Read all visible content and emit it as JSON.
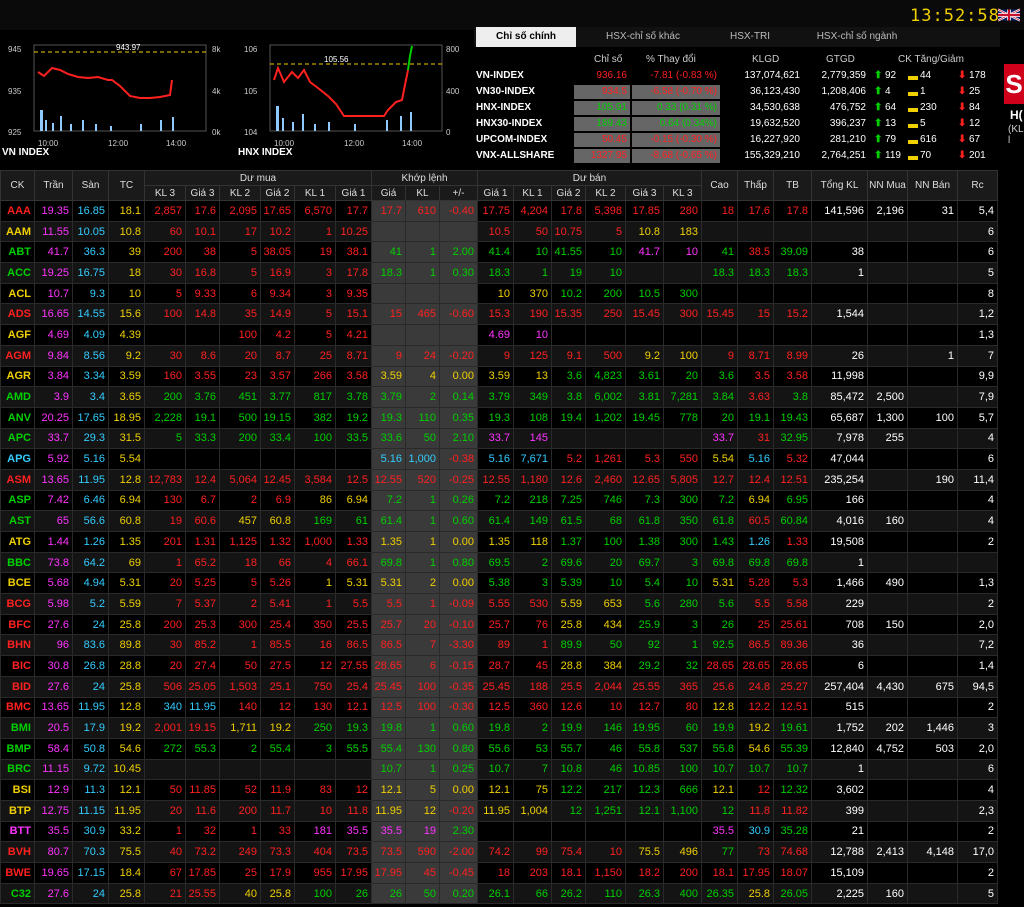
{
  "clock": "13:52:58",
  "charts": [
    {
      "title": "VN INDEX",
      "ref_label": "943.97",
      "y_left": [
        "945",
        "935",
        "925"
      ],
      "y_right": [
        "8k",
        "4k",
        "0k"
      ],
      "x": [
        "10:00",
        "12:00",
        "14:00"
      ]
    },
    {
      "title": "HNX INDEX",
      "ref_label": "105.56",
      "y_left": [
        "106",
        "105",
        "104"
      ],
      "y_right": [
        "800",
        "400",
        "0"
      ],
      "x": [
        "10:00",
        "12:00",
        "14:00"
      ]
    }
  ],
  "tabs": [
    "Chỉ số chính",
    "HSX-chỉ số khác",
    "HSX-TRI",
    "HSX-chỉ số ngành"
  ],
  "index_headers": [
    "Chỉ số",
    "% Thay đổi",
    "KLGD",
    "GTGD",
    "CK Tăng/Giảm"
  ],
  "indices": [
    {
      "name": "VN-INDEX",
      "value": "936.16",
      "change": "-7.81 (-0.83 %)",
      "klgd": "137,074,621",
      "gtgd": "2,779,359",
      "up": "92",
      "ref": "44",
      "down": "178"
    },
    {
      "name": "VN30-INDEX",
      "value": "934.5",
      "change": "-6.58 (-0.70 %)",
      "klgd": "36,123,430",
      "gtgd": "1,208,406",
      "up": "4",
      "ref": "1",
      "down": "25"
    },
    {
      "name": "HNX-INDEX",
      "value": "105.91",
      "change": "0.33 (0.31 %)",
      "klgd": "34,530,638",
      "gtgd": "476,752",
      "up": "64",
      "ref": "230",
      "down": "84"
    },
    {
      "name": "HNX30-INDEX",
      "value": "189.43",
      "change": "0.64 (0.34%)",
      "klgd": "19,632,520",
      "gtgd": "396,237",
      "up": "13",
      "ref": "5",
      "down": "12"
    },
    {
      "name": "UPCOM-INDEX",
      "value": "50.45",
      "change": "-0.15 (-0.30 %)",
      "klgd": "16,227,920",
      "gtgd": "281,210",
      "up": "79",
      "ref": "616",
      "down": "67"
    },
    {
      "name": "VNX-ALLSHARE",
      "value": "1327.95",
      "change": "-8.68 (-0.65 %)",
      "klgd": "155,329,210",
      "gtgd": "2,764,251",
      "up": "119",
      "ref": "70",
      "down": "201"
    }
  ],
  "logo_letter": "S",
  "logo_t1": "H(",
  "logo_t2": "(KL l",
  "board_group_headers": [
    "CK",
    "Trần",
    "Sàn",
    "TC",
    "Dư mua",
    "Khớp lệnh",
    "Dư bán",
    "Cao",
    "Thấp",
    "TB",
    "Tổng KL",
    "NN Mua",
    "NN Bán",
    "Rc"
  ],
  "board_sub_headers": [
    "KL 3",
    "Giá 3",
    "KL 2",
    "Giá 2",
    "KL 1",
    "Giá 1",
    "Giá",
    "KL",
    "+/-",
    "Giá 1",
    "KL 1",
    "Giá 2",
    "KL 2",
    "Giá 3",
    "KL 3"
  ],
  "rows": [
    [
      "AAA",
      "19.35",
      "16.85",
      "18.1",
      "2,857",
      "17.6",
      "2,095",
      "17.65",
      "6,570",
      "17.7",
      "17.7",
      "610",
      "-0.40",
      "17.75",
      "4,204",
      "17.8",
      "5,398",
      "17.85",
      "280",
      "18",
      "17.6",
      "17.8",
      "141,596",
      "2,196",
      "31",
      "5,4"
    ],
    [
      "AAM",
      "11.55",
      "10.05",
      "10.8",
      "60",
      "10.1",
      "17",
      "10.2",
      "1",
      "10.25",
      "",
      "",
      "",
      "10.5",
      "50",
      "10.75",
      "5",
      "10.8",
      "183",
      "",
      "",
      "",
      "",
      "",
      "",
      "6"
    ],
    [
      "ABT",
      "41.7",
      "36.3",
      "39",
      "200",
      "38",
      "5",
      "38.05",
      "19",
      "38.1",
      "41",
      "1",
      "2.00",
      "41.4",
      "10",
      "41.55",
      "10",
      "41.7",
      "10",
      "41",
      "38.5",
      "39.09",
      "38",
      "",
      "",
      "6"
    ],
    [
      "ACC",
      "19.25",
      "16.75",
      "18",
      "30",
      "16.8",
      "5",
      "16.9",
      "3",
      "17.8",
      "18.3",
      "1",
      "0.30",
      "18.3",
      "1",
      "19",
      "10",
      "",
      "",
      "18.3",
      "18.3",
      "18.3",
      "1",
      "",
      "",
      "5"
    ],
    [
      "ACL",
      "10.7",
      "9.3",
      "10",
      "5",
      "9.33",
      "6",
      "9.34",
      "3",
      "9.35",
      "",
      "",
      "",
      "10",
      "370",
      "10.2",
      "200",
      "10.5",
      "300",
      "",
      "",
      "",
      "",
      "",
      "",
      "8"
    ],
    [
      "ADS",
      "16.65",
      "14.55",
      "15.6",
      "100",
      "14.8",
      "35",
      "14.9",
      "5",
      "15.1",
      "15",
      "465",
      "-0.60",
      "15.3",
      "190",
      "15.35",
      "250",
      "15.45",
      "300",
      "15.45",
      "15",
      "15.2",
      "1,544",
      "",
      "",
      "1,2"
    ],
    [
      "AGF",
      "4.69",
      "4.09",
      "4.39",
      "",
      "",
      "100",
      "4.2",
      "5",
      "4.21",
      "",
      "",
      "",
      "4.69",
      "10",
      "",
      "",
      "",
      "",
      "",
      "",
      "",
      "",
      "",
      "",
      "1,3"
    ],
    [
      "AGM",
      "9.84",
      "8.56",
      "9.2",
      "30",
      "8.6",
      "20",
      "8.7",
      "25",
      "8.71",
      "9",
      "24",
      "-0.20",
      "9",
      "125",
      "9.1",
      "500",
      "9.2",
      "100",
      "9",
      "8.71",
      "8.99",
      "26",
      "",
      "1",
      "7"
    ],
    [
      "AGR",
      "3.84",
      "3.34",
      "3.59",
      "160",
      "3.55",
      "23",
      "3.57",
      "266",
      "3.58",
      "3.59",
      "4",
      "0.00",
      "3.59",
      "13",
      "3.6",
      "4,823",
      "3.61",
      "20",
      "3.6",
      "3.5",
      "3.58",
      "11,998",
      "",
      "",
      "9,9"
    ],
    [
      "AMD",
      "3.9",
      "3.4",
      "3.65",
      "200",
      "3.76",
      "451",
      "3.77",
      "817",
      "3.78",
      "3.79",
      "2",
      "0.14",
      "3.79",
      "349",
      "3.8",
      "6,002",
      "3.81",
      "7,281",
      "3.84",
      "3.63",
      "3.8",
      "85,472",
      "2,500",
      "",
      "7,9"
    ],
    [
      "ANV",
      "20.25",
      "17.65",
      "18.95",
      "2,228",
      "19.1",
      "500",
      "19.15",
      "382",
      "19.2",
      "19.3",
      "110",
      "0.35",
      "19.3",
      "108",
      "19.4",
      "1,202",
      "19.45",
      "778",
      "20",
      "19.1",
      "19.43",
      "65,687",
      "1,300",
      "100",
      "5,7"
    ],
    [
      "APC",
      "33.7",
      "29.3",
      "31.5",
      "5",
      "33.3",
      "200",
      "33.4",
      "100",
      "33.5",
      "33.6",
      "50",
      "2.10",
      "33.7",
      "145",
      "",
      "",
      "",
      "",
      "33.7",
      "31",
      "32.95",
      "7,978",
      "255",
      "",
      "4"
    ],
    [
      "APG",
      "5.92",
      "5.16",
      "5.54",
      "",
      "",
      "",
      "",
      "",
      "",
      "5.16",
      "1,000",
      "-0.38",
      "5.16",
      "7,671",
      "5.2",
      "1,261",
      "5.3",
      "550",
      "5.54",
      "5.16",
      "5.32",
      "47,044",
      "",
      "",
      "6"
    ],
    [
      "ASM",
      "13.65",
      "11.95",
      "12.8",
      "12,783",
      "12.4",
      "5,064",
      "12.45",
      "3,584",
      "12.5",
      "12.55",
      "520",
      "-0.25",
      "12.55",
      "1,180",
      "12.6",
      "2,460",
      "12.65",
      "5,805",
      "12.7",
      "12.4",
      "12.51",
      "235,254",
      "",
      "190",
      "11,4"
    ],
    [
      "ASP",
      "7.42",
      "6.46",
      "6.94",
      "130",
      "6.7",
      "2",
      "6.9",
      "86",
      "6.94",
      "7.2",
      "1",
      "0.26",
      "7.2",
      "218",
      "7.25",
      "746",
      "7.3",
      "300",
      "7.2",
      "6.94",
      "6.95",
      "166",
      "",
      "",
      "4"
    ],
    [
      "AST",
      "65",
      "56.6",
      "60.8",
      "19",
      "60.6",
      "457",
      "60.8",
      "169",
      "61",
      "61.4",
      "1",
      "0.60",
      "61.4",
      "149",
      "61.5",
      "68",
      "61.8",
      "350",
      "61.8",
      "60.5",
      "60.84",
      "4,016",
      "160",
      "",
      "4"
    ],
    [
      "ATG",
      "1.44",
      "1.26",
      "1.35",
      "201",
      "1.31",
      "1,125",
      "1.32",
      "1,000",
      "1.33",
      "1.35",
      "1",
      "0.00",
      "1.35",
      "118",
      "1.37",
      "100",
      "1.38",
      "300",
      "1.43",
      "1.26",
      "1.33",
      "19,508",
      "",
      "",
      "2"
    ],
    [
      "BBC",
      "73.8",
      "64.2",
      "69",
      "1",
      "65.2",
      "18",
      "66",
      "4",
      "66.1",
      "69.8",
      "1",
      "0.80",
      "69.5",
      "2",
      "69.6",
      "20",
      "69.7",
      "3",
      "69.8",
      "69.8",
      "69.8",
      "1",
      "",
      "",
      ""
    ],
    [
      "BCE",
      "5.68",
      "4.94",
      "5.31",
      "20",
      "5.25",
      "5",
      "5.26",
      "1",
      "5.31",
      "5.31",
      "2",
      "0.00",
      "5.38",
      "3",
      "5.39",
      "10",
      "5.4",
      "10",
      "5.31",
      "5.28",
      "5.3",
      "1,466",
      "490",
      "",
      "1,3"
    ],
    [
      "BCG",
      "5.98",
      "5.2",
      "5.59",
      "7",
      "5.37",
      "2",
      "5.41",
      "1",
      "5.5",
      "5.5",
      "1",
      "-0.09",
      "5.55",
      "530",
      "5.59",
      "653",
      "5.6",
      "280",
      "5.6",
      "5.5",
      "5.58",
      "229",
      "",
      "",
      "2"
    ],
    [
      "BFC",
      "27.6",
      "24",
      "25.8",
      "200",
      "25.3",
      "300",
      "25.4",
      "350",
      "25.5",
      "25.7",
      "20",
      "-0.10",
      "25.7",
      "76",
      "25.8",
      "434",
      "25.9",
      "3",
      "26",
      "25",
      "25.61",
      "708",
      "150",
      "",
      "2,0"
    ],
    [
      "BHN",
      "96",
      "83.6",
      "89.8",
      "30",
      "85.2",
      "1",
      "85.5",
      "16",
      "86.5",
      "86.5",
      "7",
      "-3.30",
      "89",
      "1",
      "89.9",
      "50",
      "92",
      "1",
      "92.5",
      "86.5",
      "89.36",
      "36",
      "",
      "",
      "7,2"
    ],
    [
      "BIC",
      "30.8",
      "26.8",
      "28.8",
      "20",
      "27.4",
      "50",
      "27.5",
      "12",
      "27.55",
      "28.65",
      "6",
      "-0.15",
      "28.7",
      "45",
      "28.8",
      "384",
      "29.2",
      "32",
      "28.65",
      "28.65",
      "28.65",
      "6",
      "",
      "",
      "1,4"
    ],
    [
      "BID",
      "27.6",
      "24",
      "25.8",
      "506",
      "25.05",
      "1,503",
      "25.1",
      "750",
      "25.4",
      "25.45",
      "100",
      "-0.35",
      "25.45",
      "188",
      "25.5",
      "2,044",
      "25.55",
      "365",
      "25.6",
      "24.8",
      "25.27",
      "257,404",
      "4,430",
      "675",
      "94,5"
    ],
    [
      "BMC",
      "13.65",
      "11.95",
      "12.8",
      "340",
      "11.95",
      "140",
      "12",
      "130",
      "12.1",
      "12.5",
      "100",
      "-0.30",
      "12.5",
      "360",
      "12.6",
      "10",
      "12.7",
      "80",
      "12.8",
      "12.2",
      "12.51",
      "515",
      "",
      "",
      "2"
    ],
    [
      "BMI",
      "20.5",
      "17.9",
      "19.2",
      "2,001",
      "19.15",
      "1,711",
      "19.2",
      "250",
      "19.3",
      "19.8",
      "1",
      "0.60",
      "19.8",
      "2",
      "19.9",
      "146",
      "19.95",
      "60",
      "19.9",
      "19.2",
      "19.61",
      "1,752",
      "202",
      "1,446",
      "3"
    ],
    [
      "BMP",
      "58.4",
      "50.8",
      "54.6",
      "272",
      "55.3",
      "2",
      "55.4",
      "3",
      "55.5",
      "55.4",
      "130",
      "0.80",
      "55.6",
      "53",
      "55.7",
      "46",
      "55.8",
      "537",
      "55.8",
      "54.6",
      "55.39",
      "12,840",
      "4,752",
      "503",
      "2,0"
    ],
    [
      "BRC",
      "11.15",
      "9.72",
      "10.45",
      "",
      "",
      "",
      "",
      "",
      "",
      "10.7",
      "1",
      "0.25",
      "10.7",
      "7",
      "10.8",
      "46",
      "10.85",
      "100",
      "10.7",
      "10.7",
      "10.7",
      "1",
      "",
      "",
      "6"
    ],
    [
      "BSI",
      "12.9",
      "11.3",
      "12.1",
      "50",
      "11.85",
      "52",
      "11.9",
      "83",
      "12",
      "12.1",
      "5",
      "0.00",
      "12.1",
      "75",
      "12.2",
      "217",
      "12.3",
      "666",
      "12.1",
      "12",
      "12.32",
      "3,602",
      "",
      "",
      "4"
    ],
    [
      "BTP",
      "12.75",
      "11.15",
      "11.95",
      "20",
      "11.6",
      "200",
      "11.7",
      "10",
      "11.8",
      "11.95",
      "12",
      "-0.20",
      "11.95",
      "1,004",
      "12",
      "1,251",
      "12.1",
      "1,100",
      "12",
      "11.8",
      "11.82",
      "399",
      "",
      "",
      "2,3"
    ],
    [
      "BTT",
      "35.5",
      "30.9",
      "33.2",
      "1",
      "32",
      "1",
      "33",
      "181",
      "35.5",
      "35.5",
      "19",
      "2.30",
      "",
      "",
      "",
      "",
      "",
      "",
      "35.5",
      "30.9",
      "35.28",
      "21",
      "",
      "",
      "2"
    ],
    [
      "BVH",
      "80.7",
      "70.3",
      "75.5",
      "40",
      "73.2",
      "249",
      "73.3",
      "404",
      "73.5",
      "73.5",
      "590",
      "-2.00",
      "74.2",
      "99",
      "75.4",
      "10",
      "75.5",
      "496",
      "77",
      "73",
      "74.68",
      "12,788",
      "2,413",
      "4,148",
      "17,0"
    ],
    [
      "BWE",
      "19.65",
      "17.15",
      "18.4",
      "67",
      "17.85",
      "25",
      "17.9",
      "955",
      "17.95",
      "17.95",
      "45",
      "-0.45",
      "18",
      "203",
      "18.1",
      "1,150",
      "18.2",
      "200",
      "18.1",
      "17.95",
      "18.07",
      "15,109",
      "",
      "",
      "2"
    ],
    [
      "C32",
      "27.6",
      "24",
      "25.8",
      "21",
      "25.55",
      "40",
      "25.8",
      "100",
      "26",
      "26",
      "50",
      "0.20",
      "26.1",
      "66",
      "26.2",
      "110",
      "26.3",
      "400",
      "26.35",
      "25.8",
      "26.05",
      "2,225",
      "160",
      "",
      "5"
    ]
  ]
}
